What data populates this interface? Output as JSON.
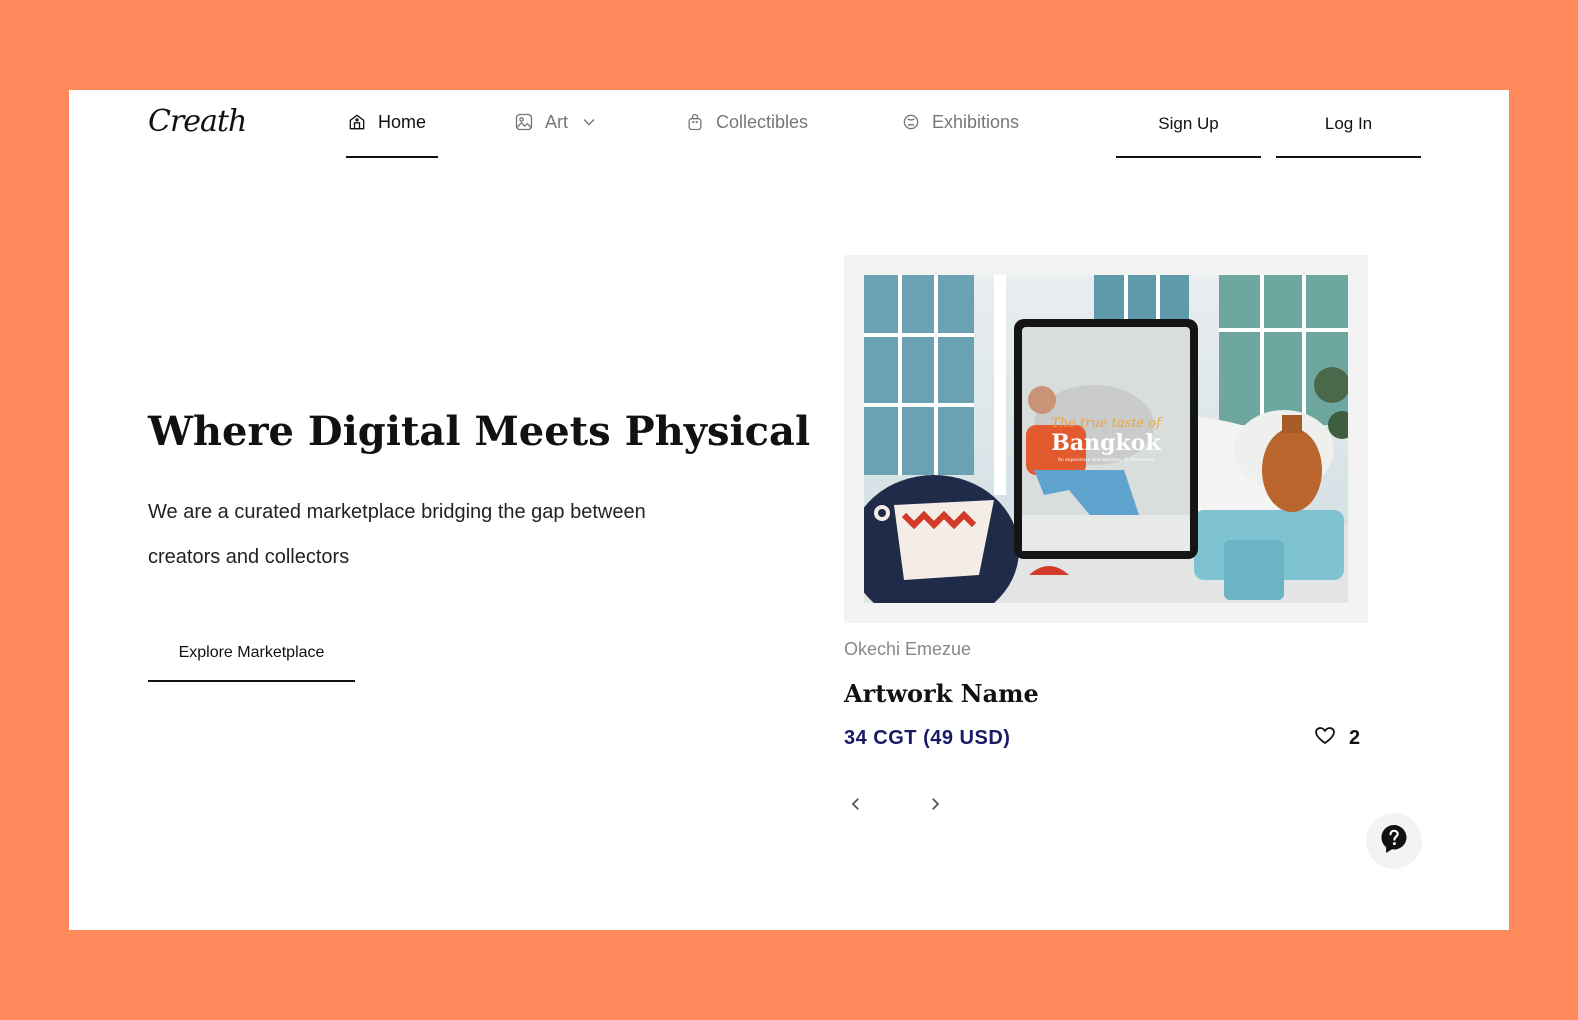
{
  "brand": {
    "logo_text": "Creath"
  },
  "nav": {
    "items": [
      {
        "label": "Home",
        "icon": "home-icon",
        "active": true
      },
      {
        "label": "Art",
        "icon": "image-icon",
        "dropdown": true
      },
      {
        "label": "Collectibles",
        "icon": "bag-icon"
      },
      {
        "label": "Exhibitions",
        "icon": "exhibition-icon"
      }
    ],
    "sign_up": "Sign Up",
    "log_in": "Log In"
  },
  "hero": {
    "title": "Where Digital Meets Physical",
    "subtitle": "We are a curated marketplace bridging the gap between creators and collectors",
    "cta": "Explore Marketplace"
  },
  "featured": {
    "image_text_script": "The true taste of",
    "image_text_title": "Bangkok",
    "image_text_tagline": "An experience that awakens all the senses",
    "artist": "Okechi Emezue",
    "name": "Artwork Name",
    "price": "34 CGT (49 USD)",
    "likes": "2"
  },
  "colors": {
    "background": "#FF8A5C",
    "price": "#1a1a66",
    "text": "#111111"
  }
}
